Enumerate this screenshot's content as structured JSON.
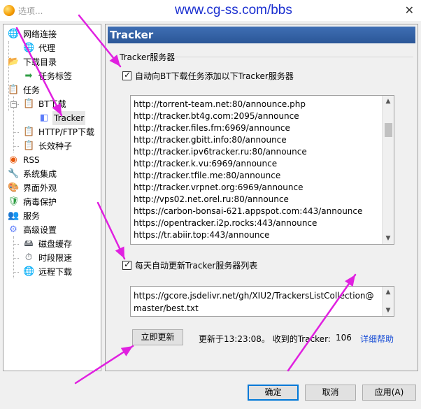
{
  "window": {
    "title": "选项...",
    "watermark": "www.cg-ss.com/bbs",
    "close_glyph": "✕"
  },
  "tree": {
    "items": [
      {
        "label": "网络连接",
        "icon": "globe-icon"
      },
      {
        "label": "代理",
        "icon": "globe-icon"
      },
      {
        "label": "下载目录",
        "icon": "folder-icon"
      },
      {
        "label": "任务标签",
        "icon": "tag-icon"
      },
      {
        "label": "任务",
        "icon": "clipboard-icon"
      },
      {
        "label": "BT下载",
        "icon": "clipboard-icon"
      },
      {
        "label": "Tracker",
        "icon": "cube-icon"
      },
      {
        "label": "HTTP/FTP下载",
        "icon": "clipboard-icon"
      },
      {
        "label": "长效种子",
        "icon": "clipboard-icon"
      },
      {
        "label": "RSS",
        "icon": "rss-icon"
      },
      {
        "label": "系统集成",
        "icon": "wrench-icon"
      },
      {
        "label": "界面外观",
        "icon": "palette-icon"
      },
      {
        "label": "病毒保护",
        "icon": "shield-icon"
      },
      {
        "label": "服务",
        "icon": "people-icon"
      },
      {
        "label": "高级设置",
        "icon": "settings-icon"
      },
      {
        "label": "磁盘缓存",
        "icon": "disk-icon"
      },
      {
        "label": "时段限速",
        "icon": "clock-icon"
      },
      {
        "label": "远程下载",
        "icon": "globe-icon"
      }
    ],
    "selected": "Tracker"
  },
  "panel": {
    "title": "Tracker",
    "group_label": "Tracker服务器",
    "auto_add": {
      "label": "自动向BT下载任务添加以下Tracker服务器",
      "checked": true
    },
    "trackers": [
      "http://torrent-team.net:80/announce.php",
      "http://tracker.bt4g.com:2095/announce",
      "http://tracker.files.fm:6969/announce",
      "http://tracker.gbitt.info:80/announce",
      "http://tracker.ipv6tracker.ru:80/announce",
      "http://tracker.k.vu:6969/announce",
      "http://tracker.tfile.me:80/announce",
      "http://tracker.vrpnet.org:6969/announce",
      "http://vps02.net.orel.ru:80/announce",
      "https://carbon-bonsai-621.appspot.com:443/announce",
      "https://opentracker.i2p.rocks:443/announce",
      "https://tr.abiir.top:443/announce"
    ],
    "auto_update": {
      "label": "每天自动更新Tracker服务器列表",
      "checked": true
    },
    "list_url": "https://gcore.jsdelivr.net/gh/XIU2/TrackersListCollection@master/best.txt",
    "update_now_label": "立即更新",
    "status_text": "更新于13:23:08。 收到的Tracker:",
    "tracker_count": "106",
    "help_link": "详细帮助"
  },
  "buttons": {
    "ok": "确定",
    "cancel": "取消",
    "apply": "应用(A)"
  },
  "colors": {
    "header": "#2b5797",
    "link": "#1a4fd6",
    "annotation_arrow": "#e020e0"
  }
}
